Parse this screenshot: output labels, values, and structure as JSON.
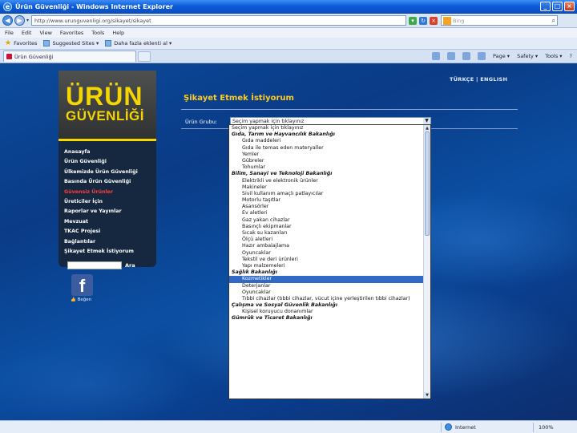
{
  "window": {
    "title": "Ürün Güvenliği - Windows Internet Explorer",
    "controls": [
      "_",
      "□",
      "×"
    ]
  },
  "address": {
    "url": "http://www.urunguvenligi.org/sikayet/sikayet",
    "search_placeholder": "Bing"
  },
  "menubar": [
    "File",
    "Edit",
    "View",
    "Favorites",
    "Tools",
    "Help"
  ],
  "favorites": {
    "label": "Favorites",
    "items": [
      "Suggested Sites ▾",
      "Daha fazla eklenti al ▾"
    ]
  },
  "tab": {
    "label": "Ürün Güvenliği"
  },
  "commandbar": [
    "Page ▾",
    "Safety ▾",
    "Tools ▾",
    "?"
  ],
  "lang": "TÜRKÇE | ENGLISH",
  "logo": {
    "line1": "ÜRÜN",
    "line2": "GÜVENLİĞİ"
  },
  "nav": [
    "Anasayfa",
    "Ürün Güvenliği",
    "Ülkemizde Ürün Güvenliği",
    "Basında Ürün Güvenliği",
    "Güvensiz Ürünler",
    "Üreticiler İçin",
    "Raporlar ve Yayınlar",
    "Mevzuat",
    "TKAC Projesi",
    "Bağlantılar",
    "Şikayet Etmek İstiyorum"
  ],
  "nav_active_index": 4,
  "search": {
    "button": "Ara"
  },
  "facebook": {
    "icon": "f",
    "label": "👍 Beğen"
  },
  "form": {
    "heading": "Şikayet Etmek İstiyorum",
    "label": "Ürün Grubu:",
    "selected": "Seçim yapmak için tıklayınız"
  },
  "dropdown": [
    {
      "t": "Seçim yapmak için tıklayınız",
      "k": "top"
    },
    {
      "t": "Gıda, Tarım ve Hayvancılık Bakanlığı",
      "k": "grp"
    },
    {
      "t": "Gıda maddeleri",
      "k": "item"
    },
    {
      "t": "Gıda ile temas eden materyaller",
      "k": "item"
    },
    {
      "t": "Yemler",
      "k": "item"
    },
    {
      "t": "Gübreler",
      "k": "item"
    },
    {
      "t": "Tohumlar",
      "k": "item"
    },
    {
      "t": "Bilim, Sanayi ve Teknoloji Bakanlığı",
      "k": "grp"
    },
    {
      "t": "Elektrikli ve elektronik ürünler",
      "k": "item"
    },
    {
      "t": "Makineler",
      "k": "item"
    },
    {
      "t": "Sivil kullanım amaçlı patlayıcılar",
      "k": "item"
    },
    {
      "t": "Motorlu taşıtlar",
      "k": "item"
    },
    {
      "t": "Asansörler",
      "k": "item"
    },
    {
      "t": "Ev aletleri",
      "k": "item"
    },
    {
      "t": "Gaz yakan cihazlar",
      "k": "item"
    },
    {
      "t": "Basınçlı ekipmanlar",
      "k": "item"
    },
    {
      "t": "Sıcak su kazanları",
      "k": "item"
    },
    {
      "t": "Ölçü aletleri",
      "k": "item"
    },
    {
      "t": "Hazır ambalajlama",
      "k": "item"
    },
    {
      "t": "Oyuncaklar",
      "k": "item"
    },
    {
      "t": "Tekstil ve deri ürünleri",
      "k": "item"
    },
    {
      "t": "Yapı malzemeleri",
      "k": "item"
    },
    {
      "t": "Sağlık Bakanlığı",
      "k": "grp"
    },
    {
      "t": "Kozmetikler",
      "k": "sel"
    },
    {
      "t": "Deterjanlar",
      "k": "item"
    },
    {
      "t": "Oyuncaklar",
      "k": "item"
    },
    {
      "t": "Tıbbi cihazlar (tıbbi cihazlar, vücut içine yerleştirilen tıbbi cihazlar)",
      "k": "item"
    },
    {
      "t": "Çalışma ve Sosyal Güvenlik Bakanlığı",
      "k": "grp"
    },
    {
      "t": "Kişisel koruyucu donanımlar",
      "k": "item"
    },
    {
      "t": "Gümrük ve Ticaret Bakanlığı",
      "k": "grp"
    }
  ],
  "status": {
    "zone": "Internet",
    "zoom": "100%"
  }
}
